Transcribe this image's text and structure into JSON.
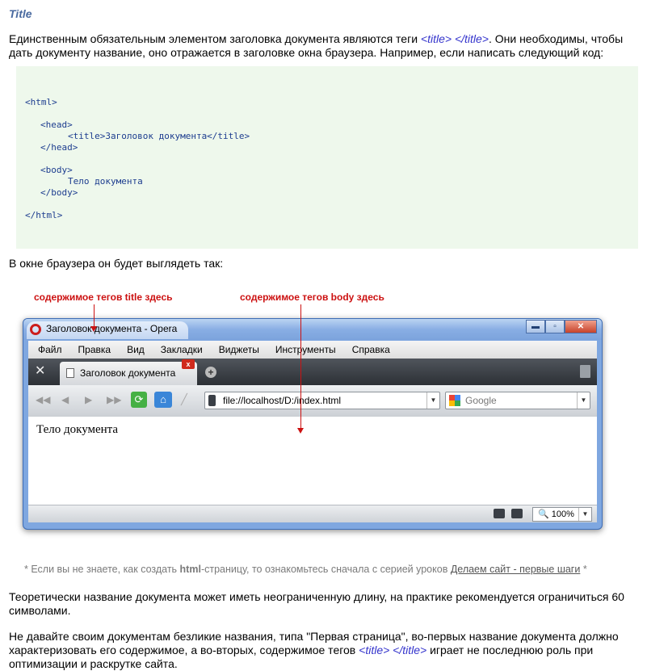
{
  "heading": "Title",
  "para1": {
    "before": "Единственным обязательным элементом заголовка документа являются теги ",
    "tag_open": "<title>",
    "tag_close": "</title>",
    "after": ". Они необходимы, чтобы дать документу название, оно отражается в заголовке окна браузера. Например, если написать следующий код:"
  },
  "code": {
    "html_open": "<html>",
    "head_open": "<head>",
    "title_line": "<title>Заголовок документа</title>",
    "head_close": "</head>",
    "body_open": "<body>",
    "body_text": "Тело документа",
    "body_close": "</body>",
    "html_close": "</html>"
  },
  "para2": "В окне браузера он будет выглядеть так:",
  "annotations": {
    "title_label": "содержимое тегов title здесь",
    "body_label": "содержимое тегов body здесь"
  },
  "browser": {
    "window_title": "Заголовок документа - Opera",
    "window_buttons": {
      "minimize": "▬",
      "maximize": "▫",
      "close": "✕"
    },
    "menu": [
      "Файл",
      "Правка",
      "Вид",
      "Закладки",
      "Виджеты",
      "Инструменты",
      "Справка"
    ],
    "tab_label": "Заголовок документа",
    "tab_close": "x",
    "address": "file://localhost/D:/index.html",
    "search_placeholder": "Google",
    "dropdown_glyph": "▼",
    "content_text": "Тело документа",
    "zoom": "100%",
    "icons": {
      "rewind": "◀◀",
      "back": "◀",
      "forward": "▶",
      "fastforward": "▶▶",
      "reload": "⟳",
      "home": "⌂",
      "wand": "╱",
      "tools": "✕",
      "new_tab": "+",
      "zoom_magnifier": "🔍"
    },
    "colors": {
      "frame": "#7fa7e0",
      "tabbar": "#2c3035",
      "close_red": "#d02a1c"
    }
  },
  "note": {
    "before": "* Если вы не знаете, как создать ",
    "html_word": "html",
    "middle": "-страницу, то ознакомьтесь сначала с серией уроков ",
    "link": "Делаем сайт - первые шаги",
    "after": " *"
  },
  "para3": "Теоретически название документа может иметь неограниченную длину, на практике рекомендуется ограничиться 60 символами.",
  "para4": {
    "before": "Не давайте своим документам безликие названия, типа \"Первая страница\", во-первых название документа должно характеризовать его содержимое, а во-вторых, содержимое тегов ",
    "tag_open": "<title>",
    "tag_close": "</title>",
    "after": " играет не последнюю роль при оптимизации и раскрутке сайта."
  }
}
